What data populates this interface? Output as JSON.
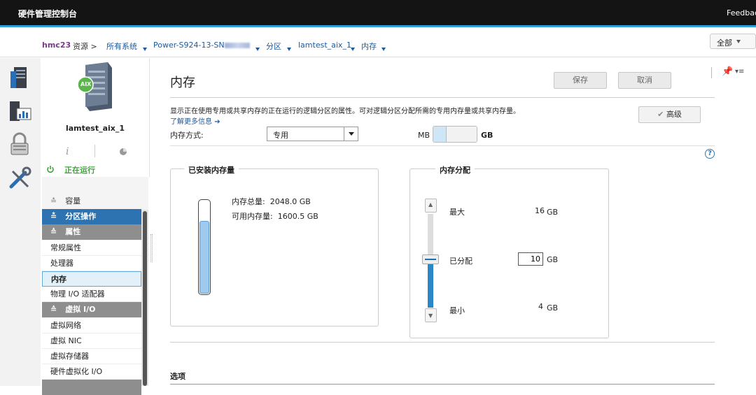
{
  "app": {
    "title": "硬件管理控制台",
    "feedback": "Feedbac"
  },
  "breadcrumb": {
    "system": "hmc23",
    "resources": "资源 >",
    "all_systems": "所有系统",
    "server": "Power-S924-13-SN",
    "partition": "分区",
    "lpar": "lamtest_aix_1",
    "memory": "内存"
  },
  "scope_button": {
    "label": "全部"
  },
  "partition_card": {
    "name": "lamtest_aix_1",
    "os_badge": "AIX",
    "status": "正在运行"
  },
  "nav": {
    "capacity": "容量",
    "partition_actions": "分区操作",
    "properties": "属性",
    "items": [
      "常规属性",
      "处理器",
      "内存",
      "物理 I/O 适配器"
    ],
    "virtual_io": "虚拟 I/O",
    "vio_items": [
      "虚拟网络",
      "虚拟 NIC",
      "虚拟存储器",
      "硬件虚拟化 I/O"
    ]
  },
  "main": {
    "title": "内存",
    "save": "保存",
    "cancel": "取消",
    "advanced": "高级",
    "description": "显示正在使用专用或共享内存的正在运行的逻辑分区的属性。可对逻辑分区分配所需的专用内存量或共享内存量。",
    "learn_more": "了解更多信息",
    "memory_mode_label": "内存方式:",
    "memory_mode_value": "专用",
    "unit_mb": "MB",
    "unit_gb": "GB",
    "installed": {
      "title": "已安装内存量",
      "total_label": "内存总量:",
      "total_value": "2048.0 GB",
      "available_label": "可用内存量:",
      "available_value": "1600.5 GB",
      "fill_fraction": 0.78
    },
    "distribution": {
      "title": "内存分配",
      "max_label": "最大",
      "max_value": "16",
      "allocated_label": "已分配",
      "allocated_value": "10",
      "min_label": "最小",
      "min_value": "4",
      "unit": "GB"
    },
    "options_title": "选项"
  },
  "colors": {
    "accent": "#2f9fd6",
    "nav_header": "#2d73b2",
    "running": "#3aa635"
  }
}
